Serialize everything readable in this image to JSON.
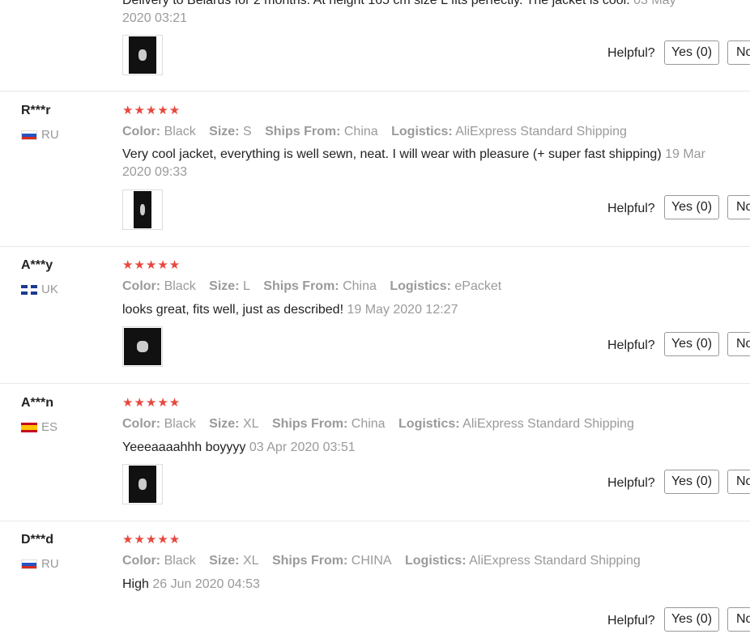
{
  "reviews": [
    {
      "user": "",
      "country": "",
      "text": "Delivery to Belarus for 2 months. At height 165 cm size L fits perfectly. The jacket is cool.",
      "date": "03 May 2020 03:21",
      "helpful_label": "Helpful?",
      "yes_label": "Yes (0)",
      "no_label": "No"
    },
    {
      "user": "R***r",
      "country": "RU",
      "flag": "ru-flag",
      "stars": "★★★★★",
      "attrs": {
        "color_k": "Color:",
        "color_v": "Black",
        "size_k": "Size:",
        "size_v": "S",
        "ships_k": "Ships From:",
        "ships_v": "China",
        "log_k": "Logistics:",
        "log_v": "AliExpress Standard Shipping"
      },
      "text": "Very cool jacket, everything is well sewn, neat. I will wear with pleasure (+ super fast shipping)",
      "date": "19 Mar 2020 09:33",
      "helpful_label": "Helpful?",
      "yes_label": "Yes (0)",
      "no_label": "No"
    },
    {
      "user": "A***y",
      "country": "UK",
      "flag": "uk-flag",
      "stars": "★★★★★",
      "attrs": {
        "color_k": "Color:",
        "color_v": "Black",
        "size_k": "Size:",
        "size_v": "L",
        "ships_k": "Ships From:",
        "ships_v": "China",
        "log_k": "Logistics:",
        "log_v": "ePacket"
      },
      "text": "looks great, fits well, just as described!",
      "date": "19 May 2020 12:27",
      "helpful_label": "Helpful?",
      "yes_label": "Yes (0)",
      "no_label": "No"
    },
    {
      "user": "A***n",
      "country": "ES",
      "flag": "es-flag",
      "stars": "★★★★★",
      "attrs": {
        "color_k": "Color:",
        "color_v": "Black",
        "size_k": "Size:",
        "size_v": "XL",
        "ships_k": "Ships From:",
        "ships_v": "China",
        "log_k": "Logistics:",
        "log_v": "AliExpress Standard Shipping"
      },
      "text": "Yeeeaaaahhh boyyyy",
      "date": "03 Apr 2020 03:51",
      "helpful_label": "Helpful?",
      "yes_label": "Yes (0)",
      "no_label": "No"
    },
    {
      "user": "D***d",
      "country": "RU",
      "flag": "ru-flag",
      "stars": "★★★★★",
      "attrs": {
        "color_k": "Color:",
        "color_v": "Black",
        "size_k": "Size:",
        "size_v": "XL",
        "ships_k": "Ships From:",
        "ships_v": "CHINA",
        "log_k": "Logistics:",
        "log_v": "AliExpress Standard Shipping"
      },
      "text": "High",
      "date": "26 Jun 2020 04:53",
      "helpful_label": "Helpful?",
      "yes_label": "Yes (0)",
      "no_label": "No"
    }
  ],
  "colors": {
    "star": "#e8473e",
    "muted": "#9a9a9a",
    "text": "#222222",
    "border": "#999999"
  }
}
